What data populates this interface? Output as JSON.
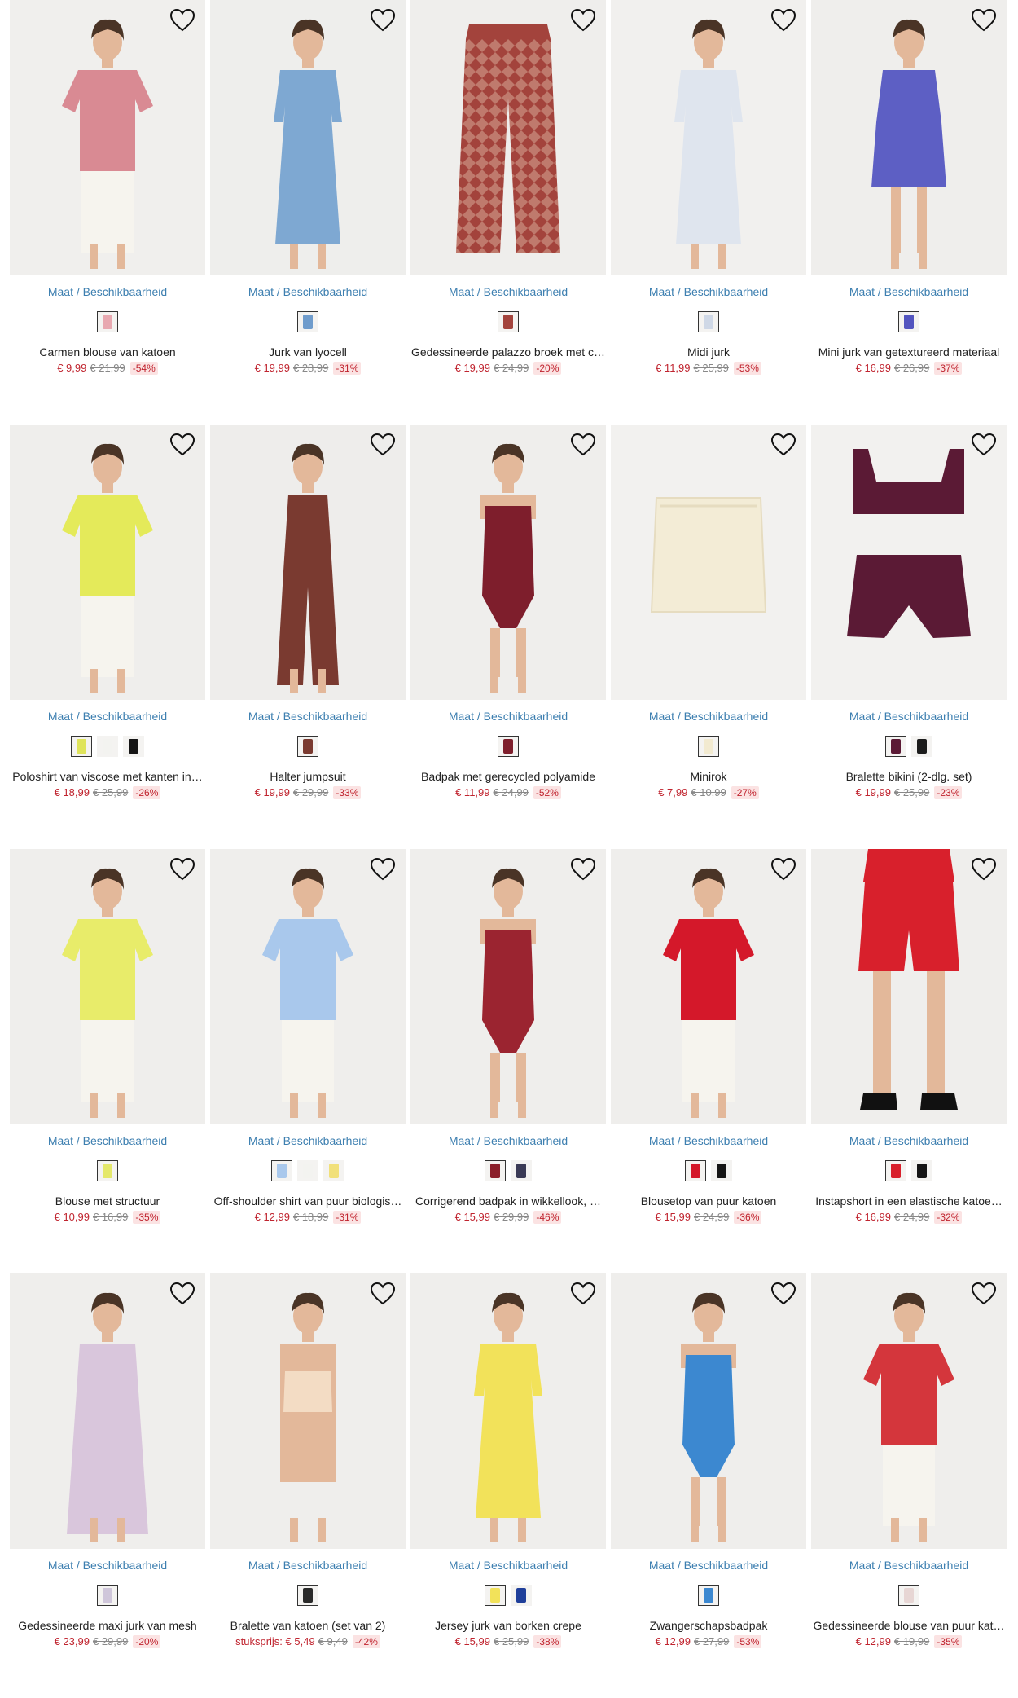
{
  "avail_label": "Maat / Beschikbaarheid",
  "products": [
    {
      "name": "Carmen blouse van katoen",
      "unit": "",
      "price": "€ 9,99",
      "old": "€ 21,99",
      "discount": "-54%",
      "bg": "#f0efed",
      "color": "#d98a93",
      "swatches": [
        "#e8a8b0"
      ],
      "shape": "top"
    },
    {
      "name": "Jurk van lyocell",
      "unit": "",
      "price": "€ 19,99",
      "old": "€ 28,99",
      "discount": "-31%",
      "bg": "#eeeeec",
      "color": "#7ea8d2",
      "swatches": [
        "#6f9ccc"
      ],
      "shape": "dress"
    },
    {
      "name": "Gedessineerde palazzo broek met c…",
      "unit": "",
      "price": "€ 19,99",
      "old": "€ 24,99",
      "discount": "-20%",
      "bg": "#efeeec",
      "color": "#a3433c",
      "swatches": [
        "#a3433c"
      ],
      "shape": "pants"
    },
    {
      "name": "Midi jurk",
      "unit": "",
      "price": "€ 11,99",
      "old": "€ 25,99",
      "discount": "-53%",
      "bg": "#f1f0ee",
      "color": "#dfe5ee",
      "swatches": [
        "#cfd8e6"
      ],
      "shape": "dress"
    },
    {
      "name": "Mini jurk van getextureerd materiaal",
      "unit": "",
      "price": "€ 16,99",
      "old": "€ 26,99",
      "discount": "-37%",
      "bg": "#efeeec",
      "color": "#5d5fc4",
      "swatches": [
        "#5355bf"
      ],
      "shape": "mini"
    },
    {
      "name": "Poloshirt van viscose met kanten in…",
      "unit": "",
      "price": "€ 18,99",
      "old": "€ 25,99",
      "discount": "-26%",
      "bg": "#efeeec",
      "color": "#e4ea5a",
      "swatches": [
        "#dfe45a",
        "#f3f3f0",
        "#151515"
      ],
      "shape": "top"
    },
    {
      "name": "Halter jumpsuit",
      "unit": "",
      "price": "€ 19,99",
      "old": "€ 29,99",
      "discount": "-33%",
      "bg": "#eeedeb",
      "color": "#7a3a30",
      "swatches": [
        "#7a3a30"
      ],
      "shape": "jumpsuit"
    },
    {
      "name": "Badpak met gerecycled polyamide",
      "unit": "",
      "price": "€ 11,99",
      "old": "€ 24,99",
      "discount": "-52%",
      "bg": "#efeeec",
      "color": "#7e1e2c",
      "swatches": [
        "#7e1e2c"
      ],
      "shape": "swim"
    },
    {
      "name": "Minirok",
      "unit": "",
      "price": "€ 7,99",
      "old": "€ 10,99",
      "discount": "-27%",
      "bg": "#f2f1ef",
      "color": "#f3ecd6",
      "swatches": [
        "#f2ead0"
      ],
      "shape": "skirt"
    },
    {
      "name": "Bralette bikini (2-dlg. set)",
      "unit": "",
      "price": "€ 19,99",
      "old": "€ 25,99",
      "discount": "-23%",
      "bg": "#f2f1ef",
      "color": "#5b1a35",
      "swatches": [
        "#5b1a35",
        "#1c1c1c"
      ],
      "shape": "bikini"
    },
    {
      "name": "Blouse met structuur",
      "unit": "",
      "price": "€ 10,99",
      "old": "€ 16,99",
      "discount": "-35%",
      "bg": "#efeeec",
      "color": "#e8ec6a",
      "swatches": [
        "#e4e86a"
      ],
      "shape": "top"
    },
    {
      "name": "Off-shoulder shirt van puur biologis…",
      "unit": "",
      "price": "€ 12,99",
      "old": "€ 18,99",
      "discount": "-31%",
      "bg": "#efeeec",
      "color": "#a9c8ec",
      "swatches": [
        "#a9c8ec",
        "#f3f3f0",
        "#f1e07a"
      ],
      "shape": "top"
    },
    {
      "name": "Corrigerend badpak in wikkellook, …",
      "unit": "",
      "price": "€ 15,99",
      "old": "€ 29,99",
      "discount": "-46%",
      "bg": "#efeeec",
      "color": "#9b2430",
      "swatches": [
        "#8b1f2a",
        "#3a3a55"
      ],
      "shape": "swim"
    },
    {
      "name": "Blousetop van puur katoen",
      "unit": "",
      "price": "€ 15,99",
      "old": "€ 24,99",
      "discount": "-36%",
      "bg": "#efeeec",
      "color": "#d4182a",
      "swatches": [
        "#d4182a",
        "#151515"
      ],
      "shape": "top"
    },
    {
      "name": "Instapshort in een elastische katoe…",
      "unit": "",
      "price": "€ 16,99",
      "old": "€ 24,99",
      "discount": "-32%",
      "bg": "#efeeec",
      "color": "#d8202c",
      "swatches": [
        "#d8202c",
        "#151515"
      ],
      "shape": "shorts"
    },
    {
      "name": "Gedessineerde maxi jurk van mesh",
      "unit": "",
      "price": "€ 23,99",
      "old": "€ 29,99",
      "discount": "-20%",
      "bg": "#efeeec",
      "color": "#d9c6dc",
      "swatches": [
        "#cfc6da"
      ],
      "shape": "maxi"
    },
    {
      "name": "Bralette van katoen (set van 2)",
      "unit": "stuksprijs: ",
      "price": "€ 5,49",
      "old": "€ 9,49",
      "discount": "-42%",
      "bg": "#efeeec",
      "color": "#f3dcc4",
      "swatches": [
        "#2a2a2a"
      ],
      "shape": "bra"
    },
    {
      "name": "Jersey jurk van borken crepe",
      "unit": "",
      "price": "€ 15,99",
      "old": "€ 25,99",
      "discount": "-38%",
      "bg": "#efeeec",
      "color": "#f2e25a",
      "swatches": [
        "#f2e25a",
        "#1f3f9a"
      ],
      "shape": "dress"
    },
    {
      "name": "Zwangerschapsbadpak",
      "unit": "",
      "price": "€ 12,99",
      "old": "€ 27,99",
      "discount": "-53%",
      "bg": "#efeeec",
      "color": "#3c88d0",
      "swatches": [
        "#3c88d0"
      ],
      "shape": "swim"
    },
    {
      "name": "Gedessineerde blouse van puur kat…",
      "unit": "",
      "price": "€ 12,99",
      "old": "€ 19,99",
      "discount": "-35%",
      "bg": "#efeeec",
      "color": "#d4363c",
      "swatches": [
        "#e7d6d4"
      ],
      "shape": "top"
    }
  ]
}
